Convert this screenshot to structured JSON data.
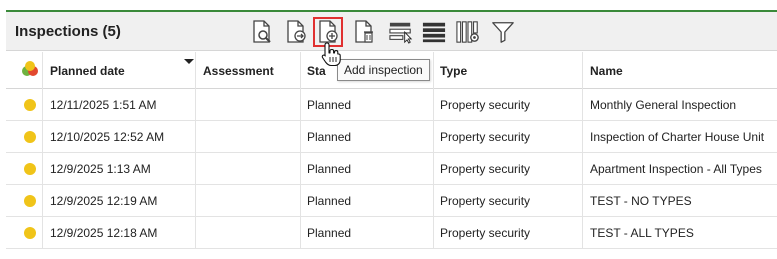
{
  "panel": {
    "title": "Inspections (5)"
  },
  "toolbar": {
    "tooltip": "Add inspection",
    "buttons": [
      "view-inspection",
      "export-inspection",
      "add-inspection",
      "delete-inspection",
      "select-columns",
      "row-density",
      "column-settings",
      "filter"
    ]
  },
  "columns": {
    "planned_date": "Planned date",
    "assessment": "Assessment",
    "status": "Sta",
    "type": "Type",
    "name": "Name"
  },
  "colors": {
    "status_dot": "#f0c419",
    "accent": "#3a8a3a"
  },
  "rows": [
    {
      "planned_date": "12/11/2025 1:51 AM",
      "assessment": "",
      "status": "Planned",
      "type": "Property security",
      "name": "Monthly General Inspection"
    },
    {
      "planned_date": "12/10/2025 12:52 AM",
      "assessment": "",
      "status": "Planned",
      "type": "Property security",
      "name": "Inspection of Charter House Unit"
    },
    {
      "planned_date": "12/9/2025 1:13 AM",
      "assessment": "",
      "status": "Planned",
      "type": "Property security",
      "name": "Apartment Inspection - All Types"
    },
    {
      "planned_date": "12/9/2025 12:19 AM",
      "assessment": "",
      "status": "Planned",
      "type": "Property security",
      "name": "TEST - NO TYPES"
    },
    {
      "planned_date": "12/9/2025 12:18 AM",
      "assessment": "",
      "status": "Planned",
      "type": "Property security",
      "name": "TEST - ALL TYPES"
    }
  ]
}
